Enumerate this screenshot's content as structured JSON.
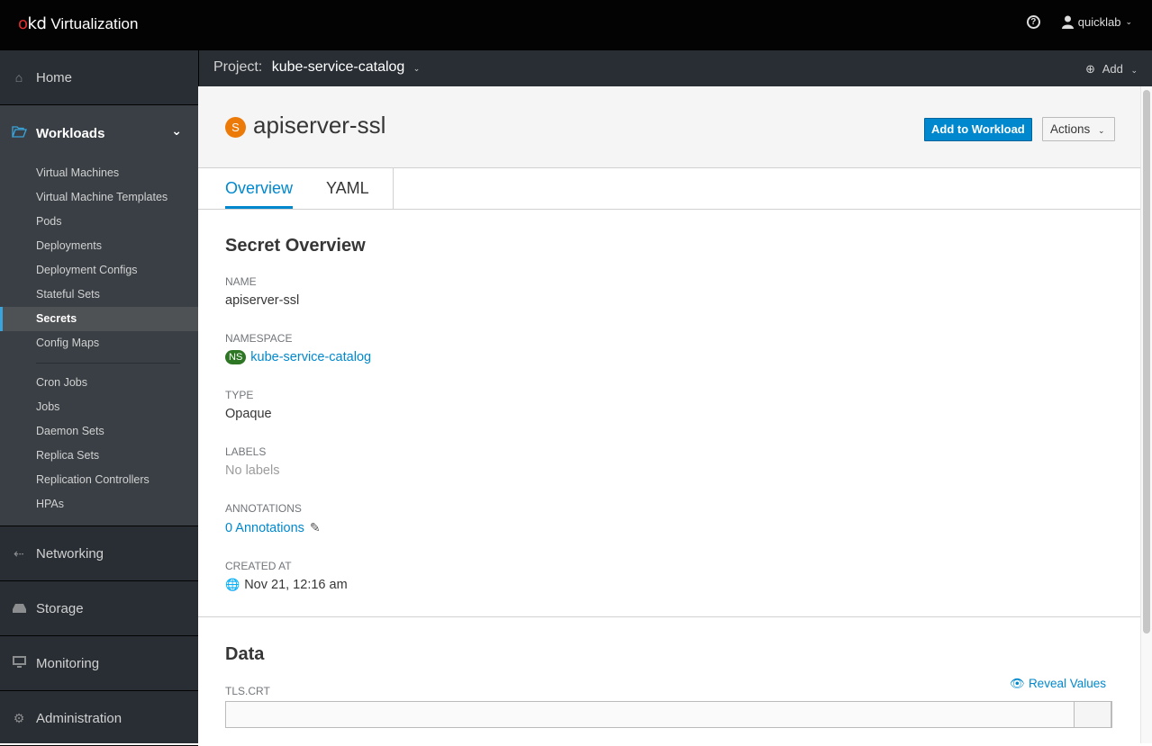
{
  "masthead": {
    "brand_logo_o": "o",
    "brand_logo_kd": "kd",
    "brand_name": "Virtualization",
    "help_icon": "?",
    "user_name": "quicklab"
  },
  "toolbar": {
    "project_label": "Project:",
    "project_value": "kube-service-catalog",
    "add_label": "Add"
  },
  "sidebar": {
    "home": "Home",
    "workloads": "Workloads",
    "workload_items": [
      "Virtual Machines",
      "Virtual Machine Templates",
      "Pods",
      "Deployments",
      "Deployment Configs",
      "Stateful Sets",
      "Secrets",
      "Config Maps",
      "Cron Jobs",
      "Jobs",
      "Daemon Sets",
      "Replica Sets",
      "Replication Controllers",
      "HPAs"
    ],
    "active_item": "Secrets",
    "networking": "Networking",
    "storage": "Storage",
    "monitoring": "Monitoring",
    "administration": "Administration"
  },
  "header": {
    "resource_badge": "S",
    "resource_name": "apiserver-ssl",
    "add_to_workload": "Add to Workload",
    "actions": "Actions"
  },
  "tabs": [
    {
      "label": "Overview",
      "active": true
    },
    {
      "label": "YAML",
      "active": false
    }
  ],
  "overview": {
    "title": "Secret Overview",
    "name_label": "NAME",
    "name_value": "apiserver-ssl",
    "namespace_label": "NAMESPACE",
    "namespace_badge": "NS",
    "namespace_value": "kube-service-catalog",
    "type_label": "TYPE",
    "type_value": "Opaque",
    "labels_label": "LABELS",
    "labels_value": "No labels",
    "annotations_label": "ANNOTATIONS",
    "annotations_value": "0 Annotations",
    "created_label": "CREATED AT",
    "created_value": "Nov 21, 12:16 am"
  },
  "data_section": {
    "title": "Data",
    "reveal": "Reveal Values",
    "keys": [
      "TLS.CRT"
    ]
  },
  "colors": {
    "accent": "#0088ce",
    "secret_badge": "#ec7a08",
    "namespace_badge": "#2d7623",
    "masthead": "#030303",
    "sidebar": "#292e34"
  }
}
